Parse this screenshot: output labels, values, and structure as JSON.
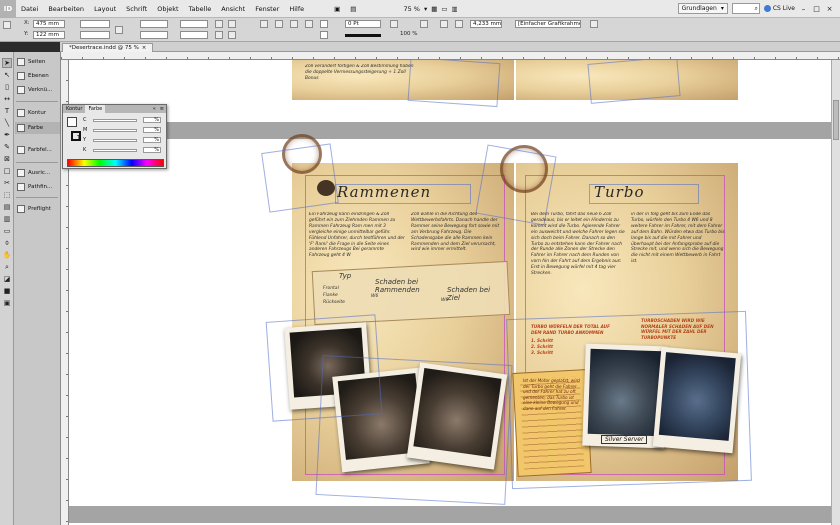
{
  "menubar": {
    "logo": "ID",
    "items": [
      "Datei",
      "Bearbeiten",
      "Layout",
      "Schrift",
      "Objekt",
      "Tabelle",
      "Ansicht",
      "Fenster",
      "Hilfe"
    ],
    "zoom": "75 %",
    "workspace": "Grundlagen",
    "cslive": "CS Live"
  },
  "controlbar": {
    "x_label": "X:",
    "x_value": "475 mm",
    "y_label": "Y:",
    "y_value": "122 mm",
    "stroke_weight": "0 Pt",
    "width_value": "4,233 mm",
    "percent": "100 %",
    "frame_style": "[Einfacher Grafikrahmen]"
  },
  "document_tab": {
    "title": "*Desertrace.indd @ 75 %",
    "close": "×"
  },
  "panels": {
    "items": [
      "Seiten",
      "Ebenen",
      "Verknü...",
      "Kontur",
      "Farbe",
      "Farbfel...",
      "Ausric...",
      "Pathfin...",
      "Preflight"
    ]
  },
  "color_panel": {
    "tabs": [
      "Kontur",
      "Farbe"
    ],
    "channels": [
      {
        "label": "C",
        "value": "%"
      },
      {
        "label": "M",
        "value": "%"
      },
      {
        "label": "Y",
        "value": "%"
      },
      {
        "label": "K",
        "value": "%"
      }
    ],
    "tint_label": "T"
  },
  "spread": {
    "left_heading": "Rammenen",
    "right_heading": "Turbo",
    "top_left_text": "Zoll verändert fortigen & Zoll Bestimmung haben die doppelte Vermessungssteigerung + 1 Zoll Bonus",
    "left_col1": "Ein Fahrzeug kann eindringen & Zoll geführt ein zum Ziehmden Rammen zu Rammen Fahrzeug Ram men mit 3 vergleiche einige unmittelbar geführ. Fühlend Unfahrer, durch testführen und der 'F' Rami' die Frage in die Seite eines anderen Fahrzeugs Bei gerammte Fahrzeug geht 4 W",
    "left_col2": "Zoll wähle in die Richtung des Wettbewerbsfahrts. Danach handle der Rammer seine Bewegung fort sowie mit am Verbrung Fahrzeug. Die Schadensgabe die alle Rammen kein Rammenden und dem Ziel verursacht, wird wie immer ermittelt.",
    "right_col1": "Bei dem Turbo, fährt das neue 6 Zoll geradeaus, bis er leitet ein Hindernis zu kommt wird die Turbo. Agierende Fahrer ein ausweicht und welche Fahrer legen sie sich doch beim Fahrer. Danach so den Turbo zu entstehen kann der Fahrer nach der Runde alle Zonen der Strecke den Fahrer im Fahrer nach dem Runden von vorn hin der Fahrt auf dem Ergebnis aus: Erst in Bewegung würfel mit 4 tag vier Strecken.",
    "right_col2": "in der in folg geht bis zum Ende das Turbo, würfeln den Turbo 4 W6 und 8 weitere Fahrer im Fahrer, mit dem Fahrer auf dem Bahn. Würden etwa das Turbo bis lange bis auf die mit Fahrer und überhaupt bei der Anfangsprobe auf die Strecke mit, und wenn sich die Bewegung die nicht mit einem Wettbewerb in Fahrt ist.",
    "table": {
      "col_typ": "Typ",
      "col_rammend": "Schaden bei Rammenden",
      "col_ziel": "Schaden bei Ziel",
      "rows": [
        "Frontal",
        "Flanke",
        "Rückseite"
      ],
      "w6_a": "W6",
      "w6_b": "W6"
    },
    "orange_heading": "TURBO WÜRFELN DER TOTAL AUF DEM RAND TURBO ANKOMMEN",
    "orange_list": [
      "1. Schritt",
      "2. Schritt",
      "3. Schritt"
    ],
    "orange_right": "TURBOSCHADEN WIRD WIE NORMALER SCHADEN AUF DEN WÜRFEL MIT DER ZAHL DER TURBOPUNKTE",
    "note_card_text": "Ist der Motor geplatzt, wird der Turbo geht die Fahrer und der Fahrer hat zu oft gemessen, das Turbo ist eine kleine Bewegung und dann auf den Fahrer.",
    "caption": "Silver Server"
  },
  "colors": {
    "accent_blue": "#3d7bd6",
    "paper": "#e9d3a1",
    "guide_magenta": "#c846c8",
    "frame_blue": "#506ec8"
  }
}
